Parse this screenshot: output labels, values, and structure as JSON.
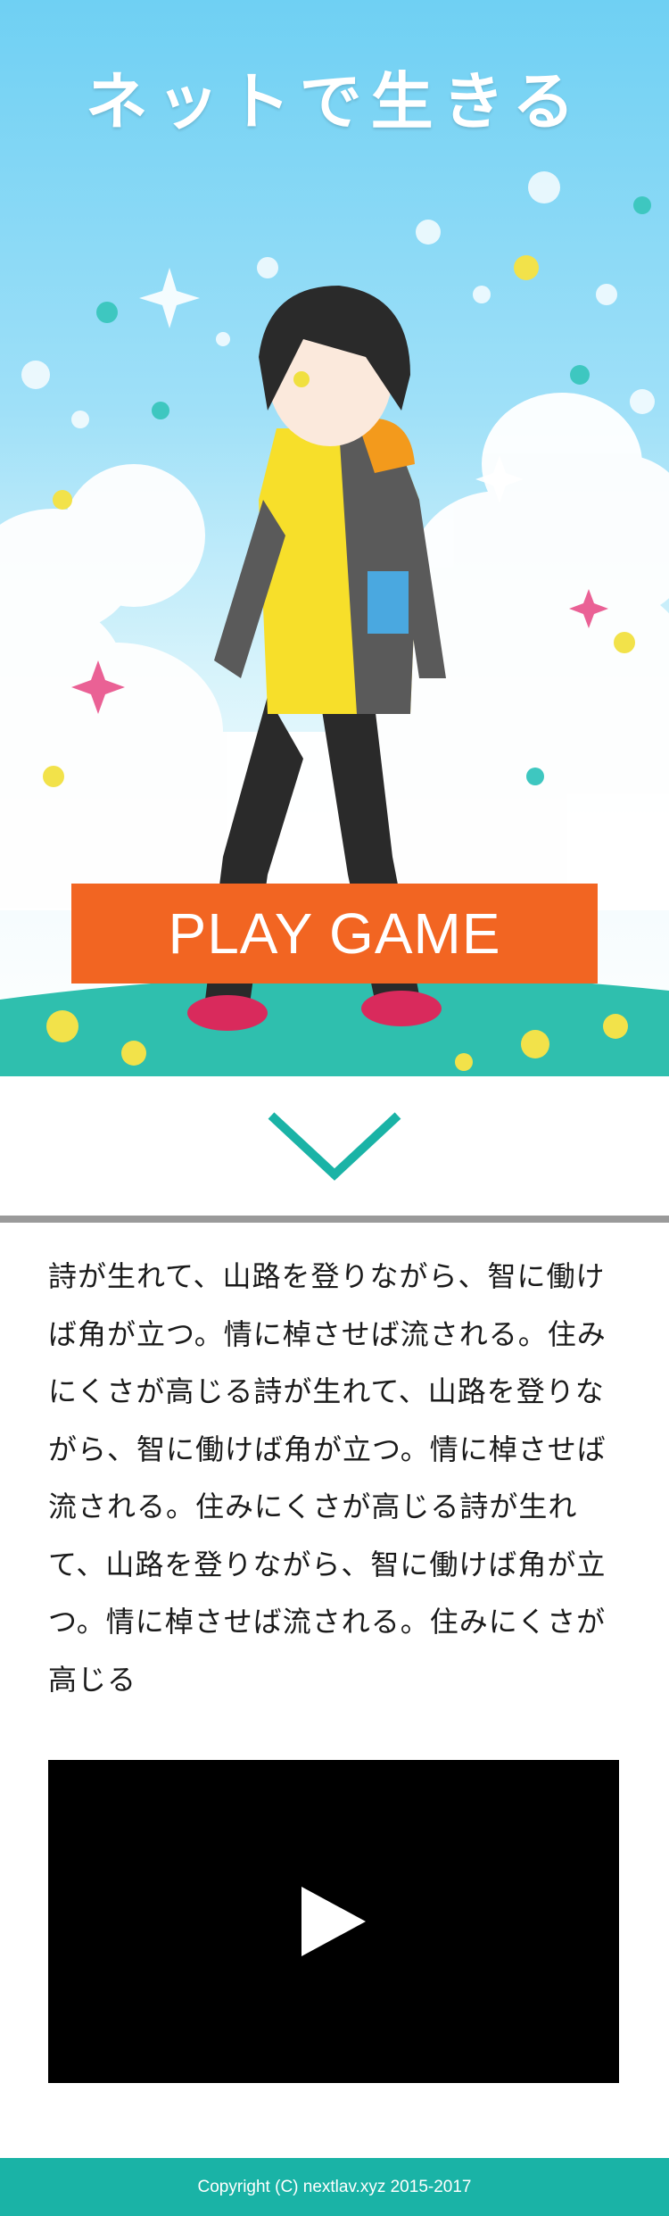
{
  "hero": {
    "title": "ネットで生きる",
    "play_label": "PLAY GAME"
  },
  "article": {
    "text": "詩が生れて、山路を登りながら、智に働けば角が立つ。情に棹させば流される。住みにくさが高じる詩が生れて、山路を登りながら、智に働けば角が立つ。情に棹させば流される。住みにくさが高じる詩が生れて、山路を登りながら、智に働けば角が立つ。情に棹させば流される。住みにくさが高じる"
  },
  "footer": {
    "copyright": "Copyright (C) nextlav.xyz 2015-2017"
  },
  "icons": {
    "scroll": "chevron-down-icon",
    "video": "play-icon"
  },
  "colors": {
    "play_button": "#f26522",
    "accent_teal": "#1ab3a6",
    "divider": "#9a9a9a"
  }
}
